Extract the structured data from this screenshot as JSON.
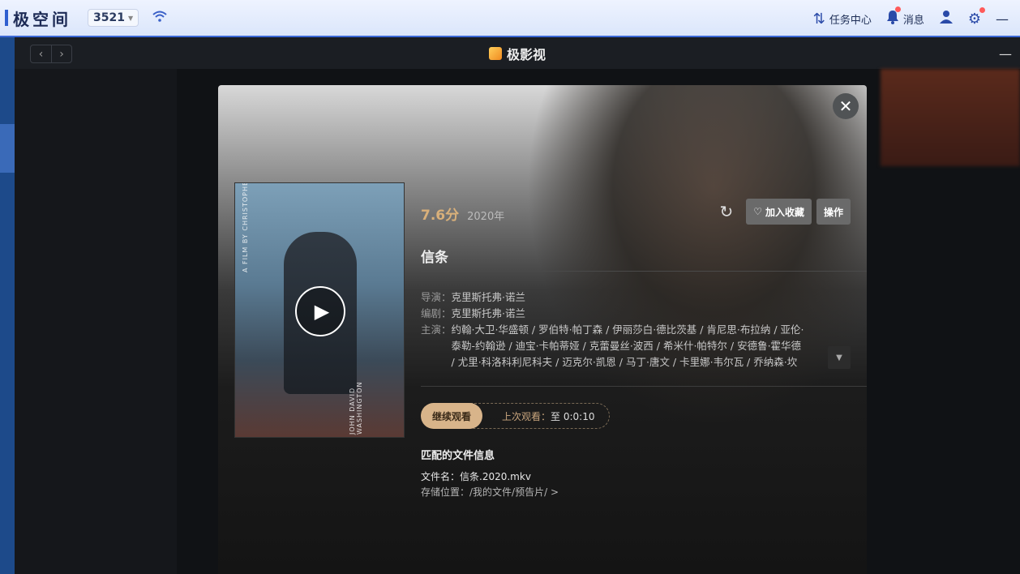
{
  "system_bar": {
    "logo": "极空间",
    "device": "3521",
    "tasks_label": "任务中心",
    "messages_label": "消息"
  },
  "window": {
    "app_title": "极影视"
  },
  "movie": {
    "score": "7.6分",
    "year": "2020年",
    "favorite_label": "加入收藏",
    "operate_label": "操作",
    "title": "信条",
    "director_label": "导演：",
    "director": "克里斯托弗·诺兰",
    "writer_label": "编剧：",
    "writer": "克里斯托弗·诺兰",
    "cast_label": "主演：",
    "cast_line1": "约翰·大卫·华盛顿 / 罗伯特·帕丁森 / 伊丽莎白·德比茨基 / 肯尼思·布拉纳 / 亚伦·",
    "cast_line2": "泰勒-约翰逊 / 迪宝·卡帕蒂娅 / 克蕾曼丝·波西 / 希米什·帕特尔 / 安德鲁·霍华德",
    "cast_line3": "/ 尤里·科洛科利尼科夫 / 迈克尔·凯恩 / 马丁·唐文 / 卡里娜·韦尔瓦 / 乔纳森·坎",
    "continue_label": "继续观看",
    "last_watched_label": "上次观看：",
    "last_watched_value": "至 0:0:10",
    "file_section_title": "匹配的文件信息",
    "file_name_label": "文件名：",
    "file_name": "信条.2020.mkv",
    "storage_label": "存储位置：",
    "storage_path": "/我的文件/预告片/ >"
  },
  "poster": {
    "credit_top": "A FILM BY CHRISTOPHER NOLAN",
    "credit_bottom": "JOHN DAVID WASHINGTON"
  },
  "colors": {
    "accent_score": "#d9b07a",
    "continue_button": "#d8b48a",
    "sysbar_border": "#3a68d6"
  }
}
